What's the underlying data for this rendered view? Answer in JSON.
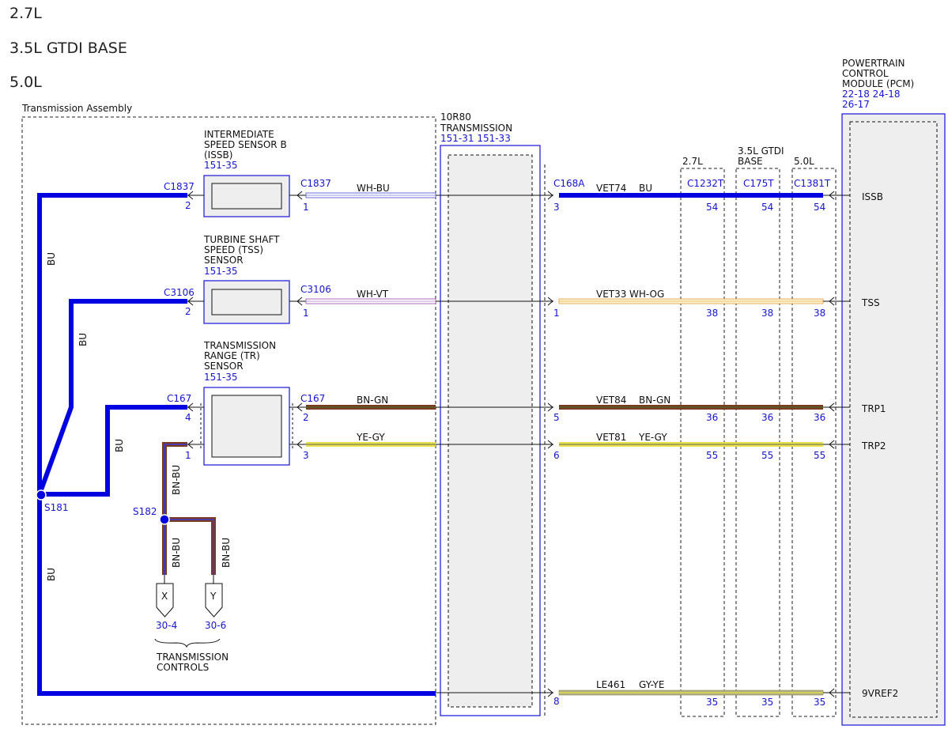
{
  "headers": [
    "2.7L",
    "3.5L GTDI BASE",
    "5.0L"
  ],
  "assembly_label": "Transmission Assembly",
  "sensors": {
    "issb": {
      "lines": [
        "INTERMEDIATE",
        "SPEED SENSOR B",
        "(ISSB)"
      ],
      "ref": "151-35",
      "connector": "C1837",
      "pin_left": "2",
      "pin_right": "1",
      "wire": "WH-BU"
    },
    "tss": {
      "lines": [
        "TURBINE SHAFT",
        "SPEED (TSS)",
        "SENSOR"
      ],
      "ref": "151-35",
      "connector": "C3106",
      "pin_left": "2",
      "pin_right": "1",
      "wire": "WH-VT"
    },
    "tr": {
      "lines": [
        "TRANSMISSION",
        "RANGE (TR)",
        "SENSOR"
      ],
      "ref": "151-35",
      "connector": "C167",
      "pin_left_top": "4",
      "pin_left_bottom": "1",
      "pin_right_top": "2",
      "pin_right_bottom": "3",
      "wire_top": "BN-GN",
      "wire_bottom": "YE-GY"
    }
  },
  "transmission": {
    "lines": [
      "10R80",
      "TRANSMISSION"
    ],
    "refs": "151-31   151-33"
  },
  "pcm": {
    "lines": [
      "POWERTRAIN",
      "CONTROL",
      "MODULE (PCM)"
    ],
    "refs": [
      "22-18 24-18",
      "26-17"
    ]
  },
  "vehicle_connector": "C168A",
  "variants": [
    {
      "name": "2.7L",
      "connector": "C1232T"
    },
    {
      "name": "3.5L GTDI",
      "name2": "BASE",
      "connector": "C175T"
    },
    {
      "name": "5.0L",
      "connector": "C1381T"
    }
  ],
  "circuits": [
    {
      "pin": "3",
      "circuit": "VET74",
      "color": "BU",
      "pcm_pin": "54",
      "signal": "ISSB"
    },
    {
      "pin": "1",
      "circuit": "VET33",
      "color": "WH-OG",
      "pcm_pin": "38",
      "signal": "TSS"
    },
    {
      "pin": "5",
      "circuit": "VET84",
      "color": "BN-GN",
      "pcm_pin": "36",
      "signal": "TRP1"
    },
    {
      "pin": "6",
      "circuit": "VET81",
      "color": "YE-GY",
      "pcm_pin": "55",
      "signal": "TRP2"
    },
    {
      "pin": "8",
      "circuit": "LE461",
      "color": "GY-YE",
      "pcm_pin": "35",
      "signal": "9VREF2"
    }
  ],
  "splices": {
    "s181": "S181",
    "s182": "S182"
  },
  "harness_colors": {
    "bu": "BU",
    "bnbu": "BN-BU"
  },
  "destinations": [
    {
      "letter": "X",
      "ref": "30-4"
    },
    {
      "letter": "Y",
      "ref": "30-6"
    }
  ],
  "destination_label": [
    "TRANSMISSION",
    "CONTROLS"
  ],
  "colors": {
    "wire_blue": "#0000e0",
    "label_blue": "#1515d6",
    "brown": "#7a3a20",
    "yellow": "#e8e04a",
    "box_fill": "#eeeeee"
  }
}
